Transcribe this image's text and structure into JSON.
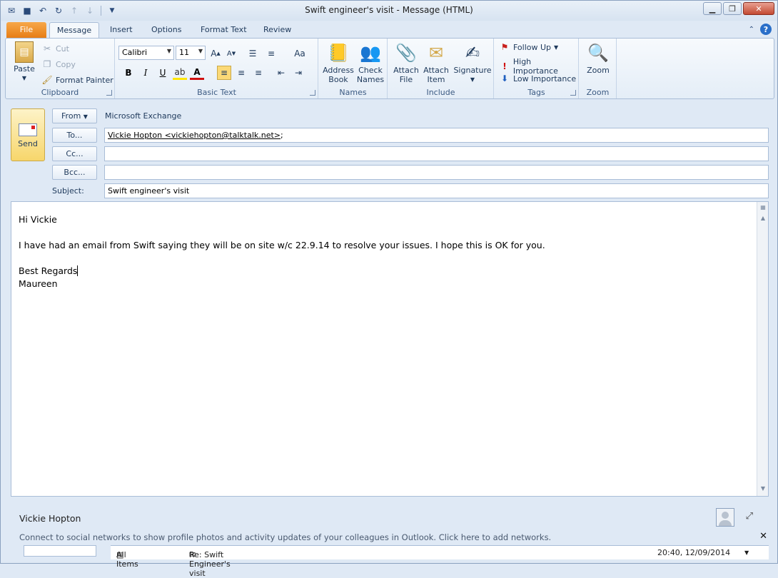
{
  "window": {
    "title": "Swift engineer's visit - Message (HTML)"
  },
  "tabs": {
    "file": "File",
    "message": "Message",
    "insert": "Insert",
    "options": "Options",
    "format_text": "Format Text",
    "review": "Review"
  },
  "clipboard": {
    "paste": "Paste",
    "cut": "Cut",
    "copy": "Copy",
    "format_painter": "Format Painter",
    "label": "Clipboard"
  },
  "basic_text": {
    "font": "Calibri",
    "size": "11",
    "label": "Basic Text"
  },
  "names": {
    "address_book_1": "Address",
    "address_book_2": "Book",
    "check_names_1": "Check",
    "check_names_2": "Names",
    "label": "Names"
  },
  "include": {
    "attach_file_1": "Attach",
    "attach_file_2": "File",
    "attach_item_1": "Attach",
    "attach_item_2": "Item",
    "signature": "Signature",
    "label": "Include"
  },
  "tags": {
    "follow_up": "Follow Up",
    "high_importance": "High Importance",
    "low_importance": "Low Importance",
    "label": "Tags"
  },
  "zoom": {
    "button": "Zoom",
    "label": "Zoom"
  },
  "compose": {
    "send": "Send",
    "from_btn": "From",
    "from_value": "Microsoft Exchange",
    "to_btn": "To...",
    "to_value": "Vickie Hopton <vickiehopton@talktalk.net>",
    "to_suffix": ";",
    "cc_btn": "Cc...",
    "bcc_btn": "Bcc...",
    "subject_label": "Subject:",
    "subject_value": "Swift engineer's visit"
  },
  "body": {
    "greeting": "Hi Vickie",
    "line1": "I have had an email from Swift saying they will be on site w/c 22.9.14 to resolve your issues.  I hope this is OK for you.",
    "closing": "Best Regards",
    "signature": "Maureen"
  },
  "people_pane": {
    "name": "Vickie Hopton",
    "info": "Connect to social networks to show profile photos and activity updates of your colleagues in Outlook. Click here to add networks.",
    "list_filter": "All Items",
    "item_subject": "Re: Swift Engineer's visit",
    "item_date": "20:40, 12/09/2014"
  }
}
